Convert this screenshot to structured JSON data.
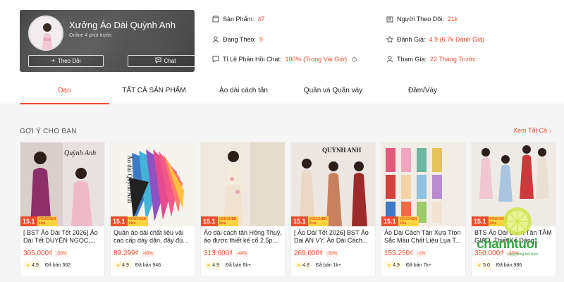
{
  "shop": {
    "name": "Xưởng Áo Dài Quỳnh Anh",
    "online_status": "Online 4 phút trước",
    "follow_label": "Theo Dõi",
    "chat_label": "Chat"
  },
  "stats": {
    "products_label": "Sản Phẩm:",
    "products_value": "47",
    "following_label": "Đang Theo:",
    "following_value": "9",
    "chat_rate_label": "Tỉ Lệ Phản Hồi Chat:",
    "chat_rate_value": "100% (Trong Vài Giờ)",
    "followers_label": "Người Theo Dõi:",
    "followers_value": "21k",
    "rating_label": "Đánh Giá:",
    "rating_value": "4.9 (6.7k Đánh Giá)",
    "joined_label": "Tham Gia:",
    "joined_value": "22 Tháng Trước"
  },
  "tabs": [
    "Dạo",
    "TẤT CẢ SẢN PHẨM",
    "Áo dài cách tân",
    "Quần và Quần váy",
    "Đầm/Váy"
  ],
  "active_tab": 0,
  "section": {
    "title": "GỢI Ý CHO BẠN",
    "see_all": "Xem Tất Cả"
  },
  "promo": {
    "badge": "15.1",
    "voucher_line1": "VOUCHER",
    "voucher_line2": "Xtra"
  },
  "products": [
    {
      "title": "[ BST Áo Dài Tết 2026] Áo Dài Tết DUYÊN NGỌC,...",
      "price": "305.000₫",
      "discount": "-50%",
      "rating": "4.9",
      "sold": "Đã bán 362",
      "brand_text": "Quỳnh Anh"
    },
    {
      "title": "Quần áo dài chất liệu vải cao cấp dày dặn, đầy đủ...",
      "price": "89.299₫",
      "discount": "-43%",
      "rating": "4.9",
      "sold": "Đã bán 946",
      "brand_text": "Áo dài Quỳnh Anh"
    },
    {
      "title": "Áo dài cách tân Hồng Thuỷ, áo được thiết kế cổ 2.5p...",
      "price": "313.600₫",
      "discount": "-44%",
      "rating": "4.9",
      "sold": "Đã bán 6k+",
      "brand_text": ""
    },
    {
      "title": "[ Áo Dài Tết 2026] BST Áo Dài AN VY, Áo Dài Cách...",
      "price": "269.000₫",
      "discount": "-50%",
      "rating": "4.8",
      "sold": "Đã bán 1k+",
      "brand_text": "QUỲNH ANH"
    },
    {
      "title": "Áo Dài Cách Tân Xưa Tron Sắc Màu Chất Liệu Lụa T...",
      "price": "153.250₫",
      "discount": "-1%",
      "rating": "4.9",
      "sold": "Đã bán 7k+",
      "brand_text": ""
    },
    {
      "title": "BTS Áo Dài Cách Tân TÂM GIAO, Thiết Kế Dáng...",
      "price": "350.000₫",
      "discount": "-27%",
      "rating": "5.0",
      "sold": "Đã bán 986",
      "brand_text": ""
    }
  ],
  "watermark": {
    "text": "chanhtuoi",
    "sub": "cộng đồng tiết kiệm"
  },
  "colors": {
    "accent": "#ee4d2d",
    "star": "#ffce3d",
    "header_bg": "#3f3f3f"
  },
  "icons": {
    "follow": "plus-icon",
    "chat": "chat-bubble-icon",
    "see_all": "chevron-right-icon"
  }
}
